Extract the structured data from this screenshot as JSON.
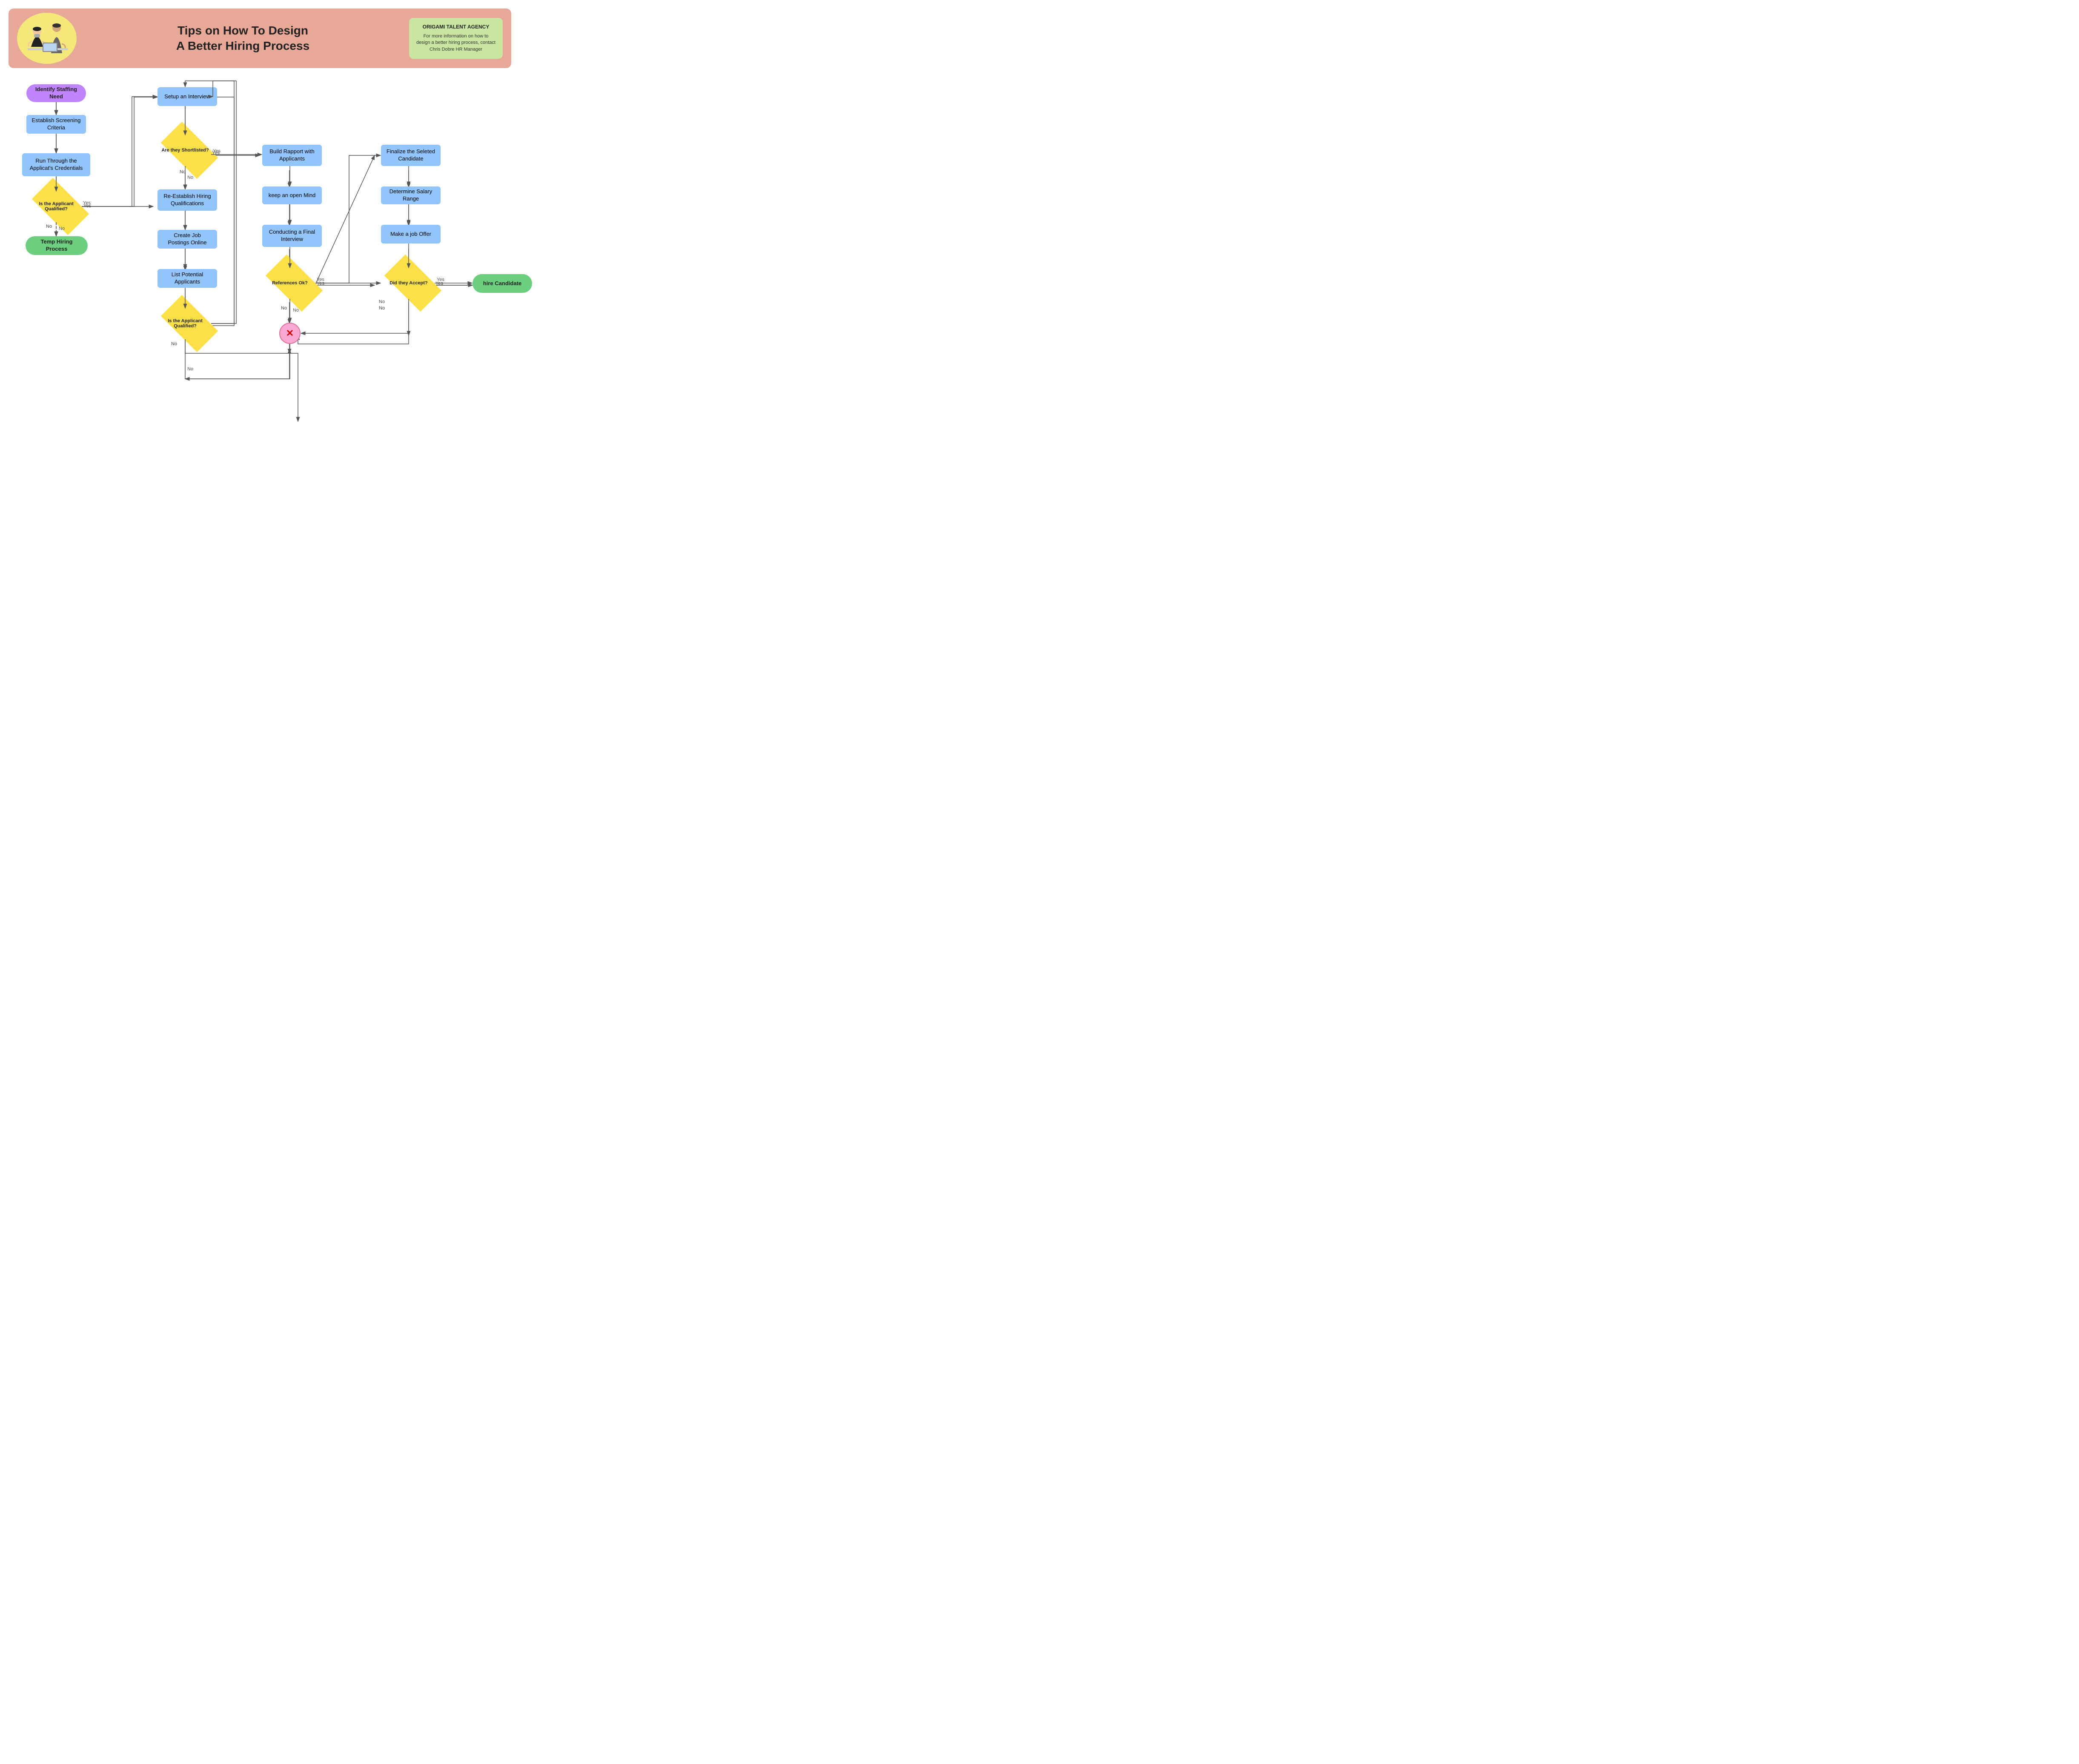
{
  "header": {
    "title_line1": "Tips on How To Design",
    "title_line2": "A Better Hiring Process",
    "info_box_title": "ORIGAMI TALENT AGENCY",
    "info_box_text": "For more information on how to design a better hiring process, contact Chris Dobre HR Manager"
  },
  "nodes": {
    "identify_staffing": "Identify Staffing Need",
    "establish_screening": "Establish Screening Criteria",
    "run_credentials": "Run Through the Applicat's Credentials",
    "is_qualified_1": "Is the Applicant Qualified?",
    "temp_hiring": "Temp Hiring Process",
    "setup_interview": "Setup an Interview",
    "are_shortlisted": "Are they Shortlisted?",
    "re_establish": "Re-Establish Hiring Qualifications",
    "create_postings": "Create Job Postings Online",
    "list_applicants": "List Potential Applicants",
    "is_qualified_2": "Is the Applicant Qualified?",
    "build_rapport": "Build Rapport with Applicants",
    "keep_open_mind": "keep an open Mind",
    "conducting_interview": "Conducting a Final Interview",
    "references_ok": "References Ok?",
    "finalize_candidate": "Finalize the Seleted Candidate",
    "determine_salary": "Determine Salary Range",
    "make_offer": "Make a job Offer",
    "did_accept": "Did they Accept?",
    "hire_candidate": "hire Candidate"
  },
  "labels": {
    "yes": "Yes",
    "no": "No"
  }
}
